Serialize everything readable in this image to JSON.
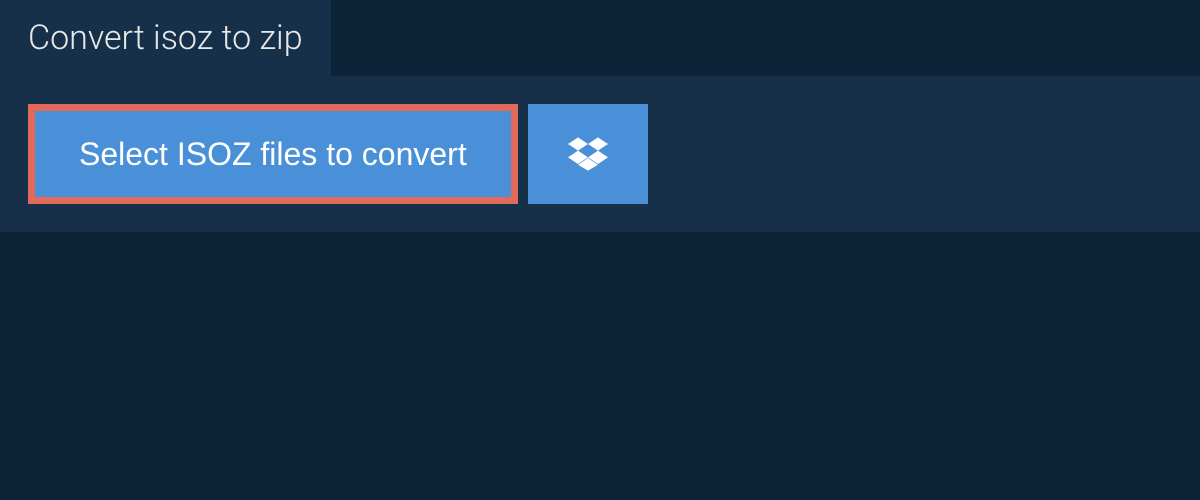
{
  "tab": {
    "label": "Convert isoz to zip"
  },
  "actions": {
    "select_label": "Select ISOZ files to convert"
  }
}
